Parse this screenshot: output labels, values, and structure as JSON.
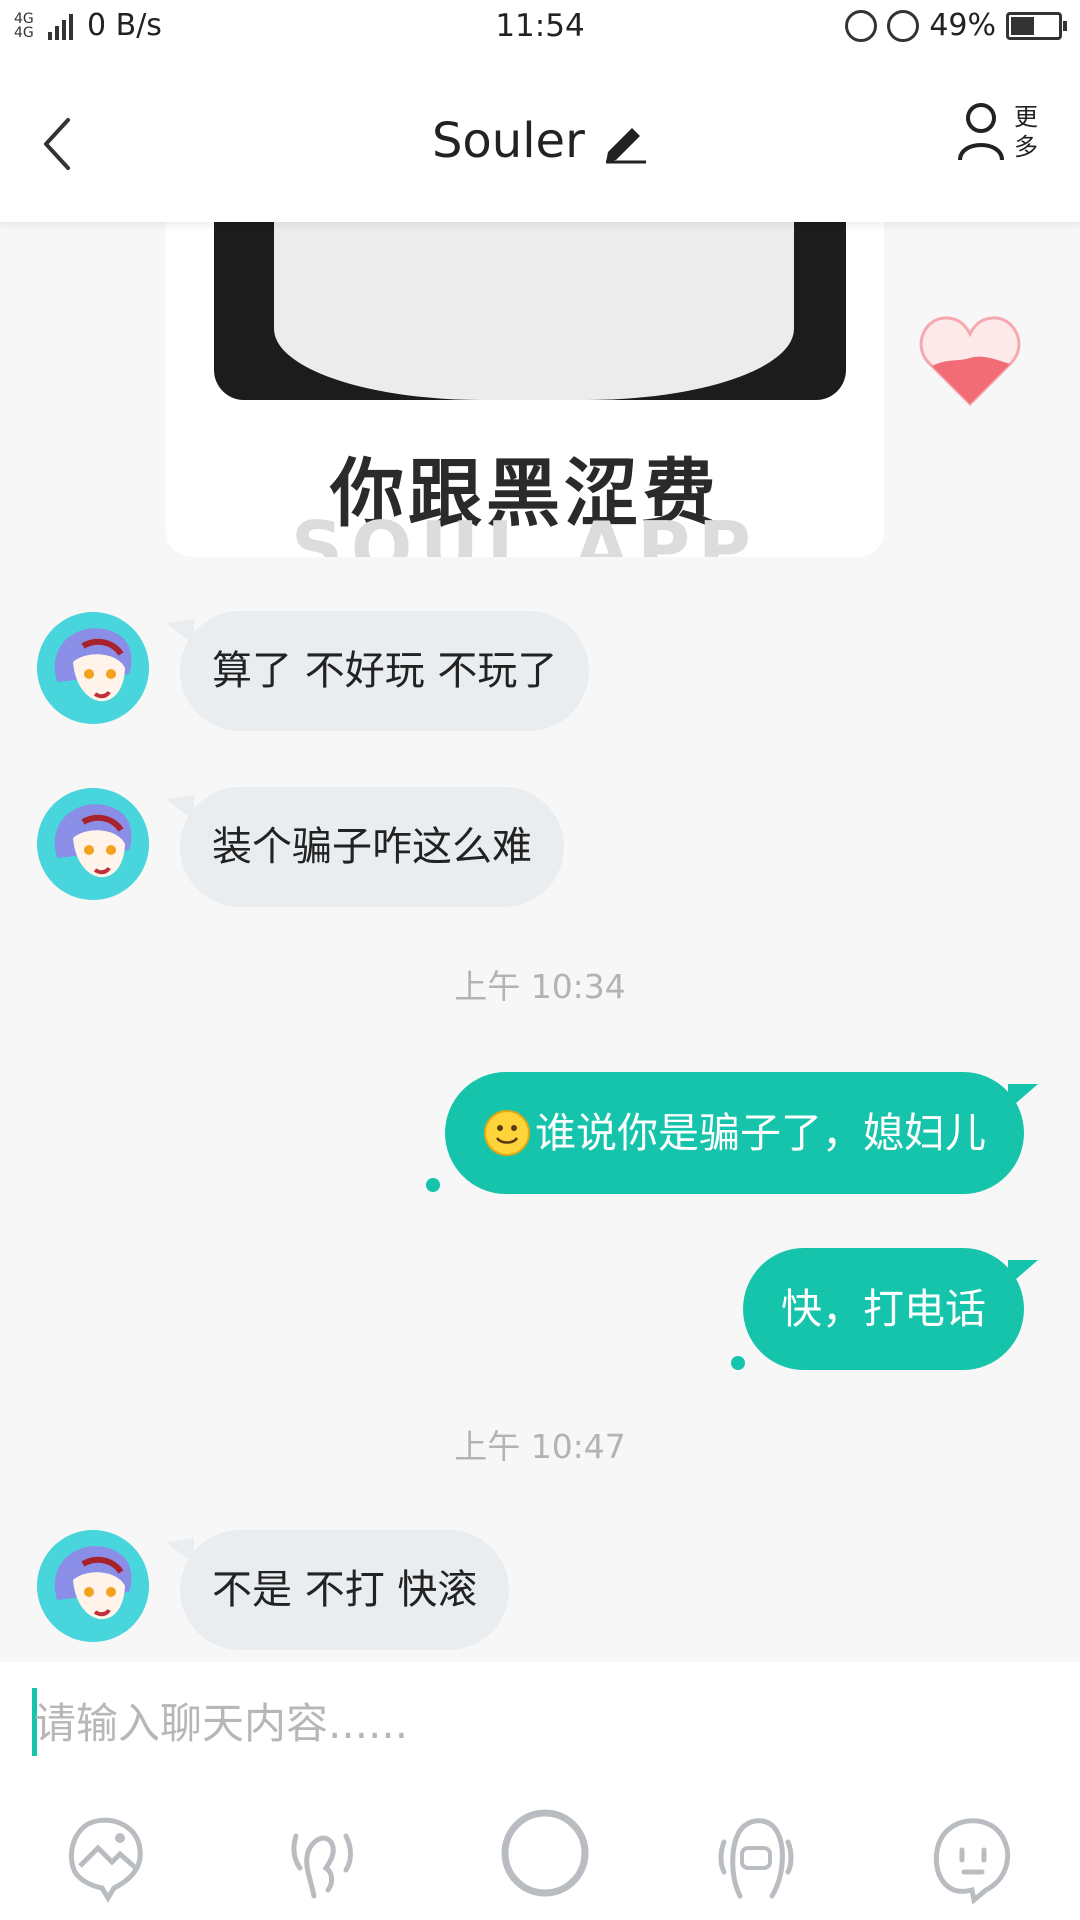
{
  "status_bar": {
    "network": "4G 4G",
    "speed": "0 B/s",
    "time": "11:54",
    "battery": "49%",
    "battery_level": 0.49
  },
  "header": {
    "title": "Souler",
    "more_label": "更多"
  },
  "image_message": {
    "caption": "你跟黑涩费",
    "watermark": "SOUL APP"
  },
  "messages": [
    {
      "side": "left",
      "text": "算了 不好玩 不玩了"
    },
    {
      "side": "left",
      "text": "装个骗子咋这么难"
    },
    {
      "side": "time",
      "text": "上午 10:34"
    },
    {
      "side": "right",
      "text": "谁说你是骗子了，媳妇儿",
      "emoji": "smile-emoji"
    },
    {
      "side": "right",
      "text": "快，打电话"
    },
    {
      "side": "time",
      "text": "上午 10:47"
    },
    {
      "side": "left",
      "text": "不是 不打 快滚"
    }
  ],
  "input": {
    "placeholder": "请输入聊天内容......"
  },
  "toolbar": [
    "image-icon",
    "voice-gesture-icon",
    "record-circle-icon",
    "call-icon",
    "emoji-icon"
  ],
  "colors": {
    "accent": "#15c4ab",
    "bubble_left": "#eaedf0",
    "background": "#f7f7f8",
    "avatar_bg": "#48d6dc",
    "heart": "#f16c74"
  }
}
